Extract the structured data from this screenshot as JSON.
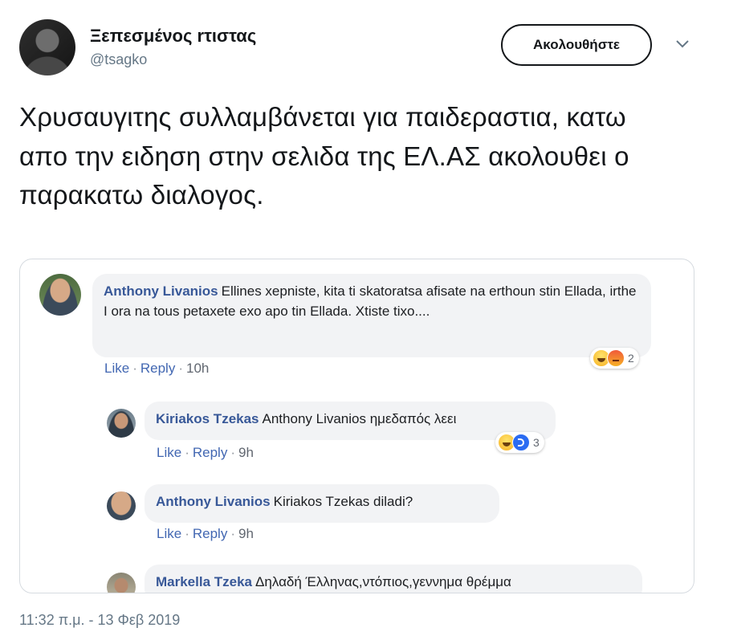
{
  "tweet": {
    "author_name": "Ξεπεσμένος rτιστας",
    "author_handle": "@tsagko",
    "follow_label": "Ακολουθήστε",
    "text": "Χρυσαυγιτης συλλαμβάνεται για παιδεραστια, κατω απο την ειδηση στην σελιδα της ΕΛ.ΑΣ ακολουθει ο παρακατω διαλογος.",
    "timestamp": "11:32 π.μ. - 13 Φεβ 2019",
    "icons": {
      "menu": "chevron-down-icon"
    }
  },
  "comments": [
    {
      "name": "Anthony Livanios",
      "text": "Ellines xepniste, kita ti skatoratsa afisate na erthoun stin Ellada, irthe I ora na tous petaxete exo apo tin Ellada. Xtiste tixo....",
      "like": "Like",
      "reply": "Reply",
      "time": "10h",
      "reactions": {
        "icons": [
          "haha-icon",
          "angry-icon"
        ],
        "count": "2"
      }
    },
    {
      "name": "Kiriakos Tzekas",
      "text": "Anthony Livanios ημεδαπός λεει",
      "like": "Like",
      "reply": "Reply",
      "time": "9h",
      "reactions": {
        "icons": [
          "haha-icon",
          "like-icon"
        ],
        "count": "3"
      }
    },
    {
      "name": "Anthony Livanios",
      "text": "Kiriakos Tzekas diladi?",
      "like": "Like",
      "reply": "Reply",
      "time": "9h"
    },
    {
      "name": "Markella Tzeka",
      "text": "Δηλαδή Έλληνας,ντόπιος,γεννημα θρέμμα"
    }
  ],
  "colors": {
    "fb_name": "#385898",
    "fb_link": "#4267b2",
    "bubble_bg": "#f2f3f5",
    "twitter_gray": "#657786"
  }
}
